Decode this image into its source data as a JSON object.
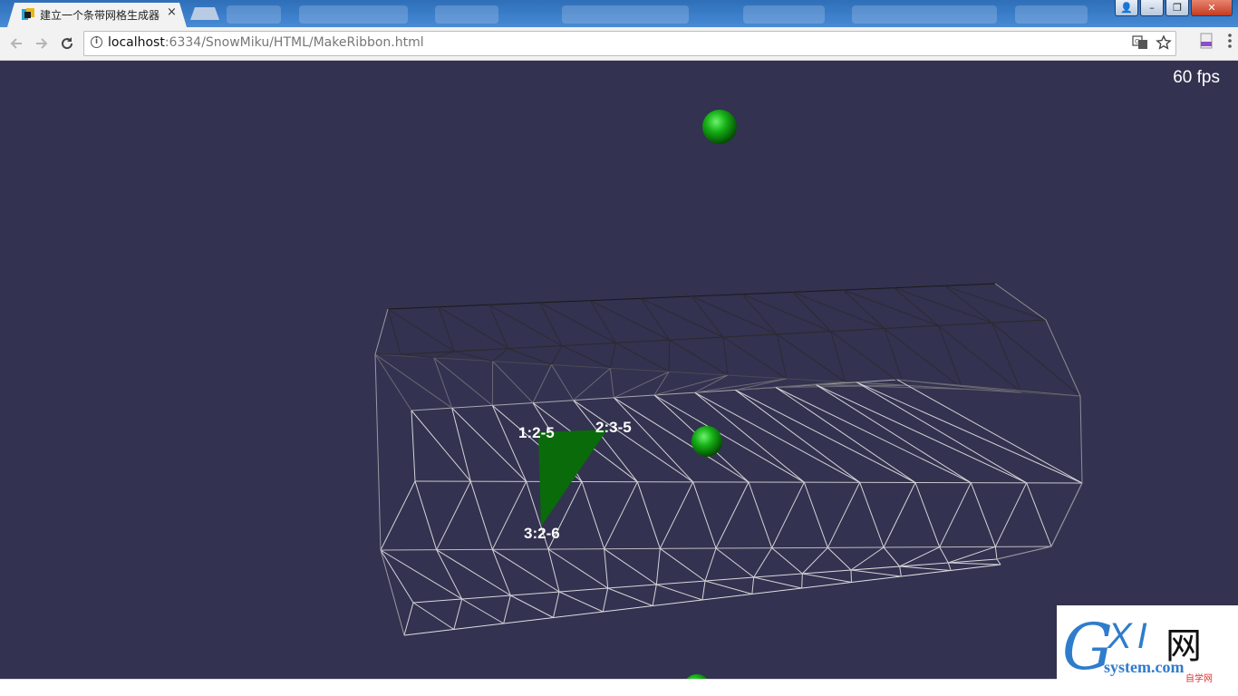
{
  "browser": {
    "tab": {
      "title": "建立一个条带网格生成器",
      "close_label": "×"
    },
    "window_buttons": {
      "user": "👤",
      "minimize": "–",
      "maximize": "❐",
      "close": "✕"
    },
    "address_bar": {
      "host": "localhost",
      "rest": ":6334/SnowMiku/HTML/MakeRibbon.html"
    }
  },
  "viewport": {
    "background": "#333250",
    "fps_text": "60 fps",
    "vertex_labels": [
      "1:2-5",
      "2:3-5",
      "3:2-6"
    ],
    "highlight_color": "#0a6b0a",
    "sphere_color": "#1db31d"
  },
  "watermark": {
    "g": "G",
    "xi": "XI",
    "wang": "网",
    "site": "system.com",
    "tag": "自学网"
  }
}
